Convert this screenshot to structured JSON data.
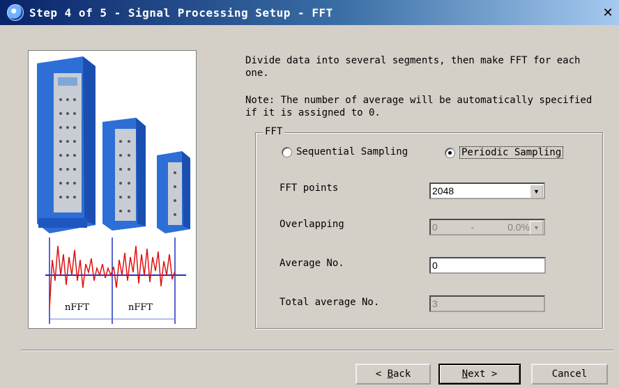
{
  "window": {
    "title": "Step 4 of 5 - Signal Processing Setup - FFT",
    "close_label": "✕"
  },
  "picture": {
    "segment_label_1": "nFFT",
    "segment_label_2": "nFFT",
    "colors": {
      "device_blue": "#2d6fd6",
      "signal_red": "#e01010",
      "axis_blue": "#2030c0"
    }
  },
  "description": {
    "line1": "Divide data into several segments, then make FFT for each one.",
    "line2": "Note: The number of average will be automatically specified if it is assigned to 0."
  },
  "fft_group": {
    "title": "FFT",
    "sampling": {
      "sequential_label": "Sequential Sampling",
      "periodic_label": "Periodic Sampling",
      "selected": "periodic"
    },
    "fft_points": {
      "label": "FFT points",
      "value": "2048"
    },
    "overlapping": {
      "label": "Overlapping",
      "value_left": "0",
      "separator": "-",
      "value_right": "0.0%"
    },
    "average_no": {
      "label": "Average No.",
      "value": "0"
    },
    "total_average_no": {
      "label": "Total average No.",
      "value": "3"
    }
  },
  "buttons": {
    "back": {
      "prefix": "< ",
      "mnemonic": "B",
      "rest": "ack"
    },
    "next": {
      "mnemonic": "N",
      "rest": "ext >"
    },
    "cancel": "Cancel"
  }
}
